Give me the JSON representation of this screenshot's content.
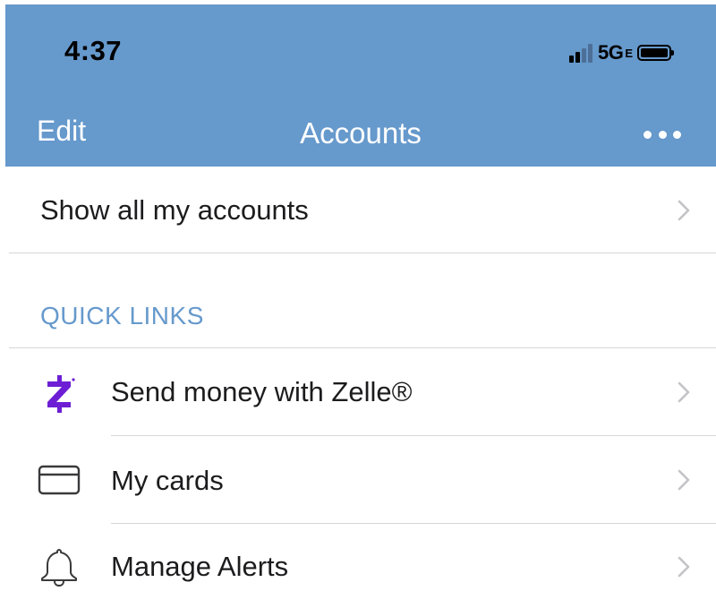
{
  "status_bar": {
    "time": "4:37",
    "network": "5G",
    "network_sub": "E"
  },
  "nav": {
    "edit_label": "Edit",
    "title": "Accounts"
  },
  "show_all": {
    "label": "Show all my accounts"
  },
  "quick_links": {
    "header": "QUICK LINKS",
    "items": [
      {
        "label": "Send money with Zelle®",
        "icon": "zelle-icon"
      },
      {
        "label": "My cards",
        "icon": "card-icon"
      },
      {
        "label": "Manage Alerts",
        "icon": "bell-icon"
      }
    ]
  },
  "colors": {
    "header_bg": "#6699cc",
    "accent": "#6699cc",
    "zelle_purple": "#6d1ed4"
  }
}
